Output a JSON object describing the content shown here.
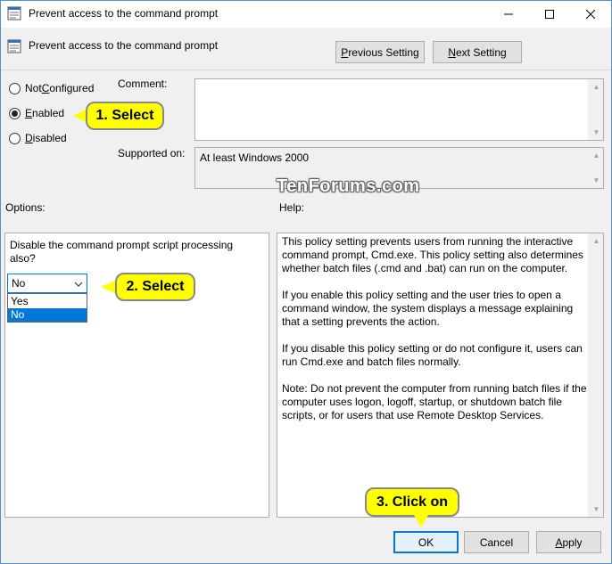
{
  "window": {
    "title": "Prevent access to the command prompt",
    "icon": "policy-setting-icon",
    "controls": [
      "minimize-icon",
      "maximize-icon",
      "close-icon"
    ]
  },
  "header": {
    "setting_name": "Prevent access to the command prompt",
    "previous_button": {
      "accel": "P",
      "rest": "revious Setting"
    },
    "next_button": {
      "accel": "N",
      "rest": "ext Setting"
    }
  },
  "state": {
    "options": [
      {
        "accel": "C",
        "before": "Not ",
        "after": "onfigured",
        "selected": false
      },
      {
        "accel": "E",
        "before": "",
        "after": "nabled",
        "selected": true
      },
      {
        "accel": "D",
        "before": "",
        "after": "isabled",
        "selected": false
      }
    ]
  },
  "comment": {
    "label": "Comment:",
    "value": ""
  },
  "supported": {
    "label": "Supported on:",
    "value": "At least Windows 2000"
  },
  "options_panel": {
    "label": "Options:",
    "question": "Disable the command prompt script processing also?",
    "selected": "No",
    "dropdown_items": [
      "Yes",
      "No"
    ]
  },
  "help_panel": {
    "label": "Help:",
    "paragraphs": [
      "This policy setting prevents users from running the interactive command prompt, Cmd.exe.  This policy setting also determines whether batch files (.cmd and .bat) can run on the computer.",
      "If you enable this policy setting and the user tries to open a command window, the system displays a message explaining that a setting prevents the action.",
      "If you disable this policy setting or do not configure it, users can run Cmd.exe and batch files normally.",
      "Note: Do not prevent the computer from running batch files if the computer uses logon, logoff, startup, or shutdown batch file scripts, or for users that use Remote Desktop Services."
    ]
  },
  "footer": {
    "ok": "OK",
    "cancel": "Cancel",
    "apply": {
      "accel": "A",
      "rest": "pply"
    }
  },
  "watermark": "TenForums.com",
  "callouts": {
    "step1": "1. Select",
    "step2": "2. Select",
    "step3": "3. Click on"
  },
  "colors": {
    "accent": "#0078d7",
    "callout": "#ffff00",
    "window_bg": "#f0f0f0"
  }
}
